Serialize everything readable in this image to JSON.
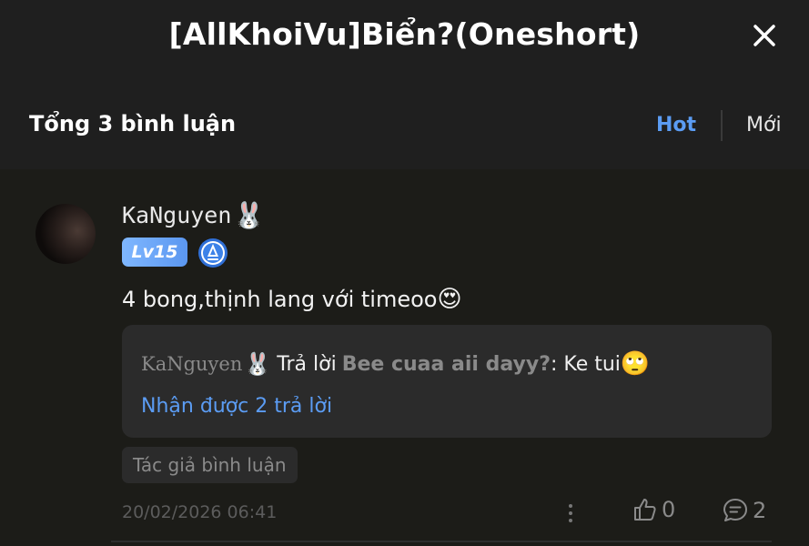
{
  "header": {
    "title": "[AllKhoiVu]Biển?(Oneshort)"
  },
  "comments_bar": {
    "total": "Tổng 3 bình luận",
    "sort_hot": "Hot",
    "sort_new": "Mới"
  },
  "comment": {
    "username": "KaNguyen",
    "username_emoji": "🐰",
    "level": "Lv15",
    "text": "4 bong,thịnh lang với timeoo",
    "text_emoji": "😍",
    "reply": {
      "user": "KaNguyen",
      "user_emoji": "🐰",
      "verb": "Trả lời",
      "target": "Bee cuaa aii dayy?",
      "text": ": Ke tui",
      "text_emoji": "🙄",
      "more_replies": "Nhận được 2 trả lời"
    },
    "author_tag": "Tác giả bình luận",
    "timestamp": "20/02/2026 06:41",
    "likes": "0",
    "replies": "2"
  },
  "colors": {
    "accent": "#5b9cf3",
    "background": "#1d1d1d",
    "muted": "#8a8a8a"
  },
  "icons": {
    "close": "close-icon",
    "medal": "medal-icon",
    "more": "more-vertical-icon",
    "like": "thumbs-up-icon",
    "reply": "chat-bubble-icon"
  }
}
